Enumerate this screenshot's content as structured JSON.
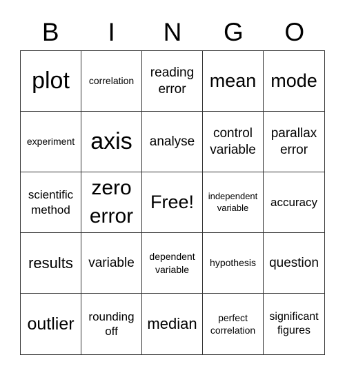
{
  "header": {
    "letters": [
      "B",
      "I",
      "N",
      "G",
      "O"
    ]
  },
  "board": {
    "rows": [
      [
        "plot",
        "correlation",
        "reading error",
        "mean",
        "mode"
      ],
      [
        "experiment",
        "axis",
        "analyse",
        "control variable",
        "parallax error"
      ],
      [
        "scientific method",
        "zero error",
        "Free!",
        "independent variable",
        "accuracy"
      ],
      [
        "results",
        "variable",
        "dependent variable",
        "hypothesis",
        "question"
      ],
      [
        "outlier",
        "rounding off",
        "median",
        "perfect correlation",
        "significant figures"
      ]
    ]
  }
}
